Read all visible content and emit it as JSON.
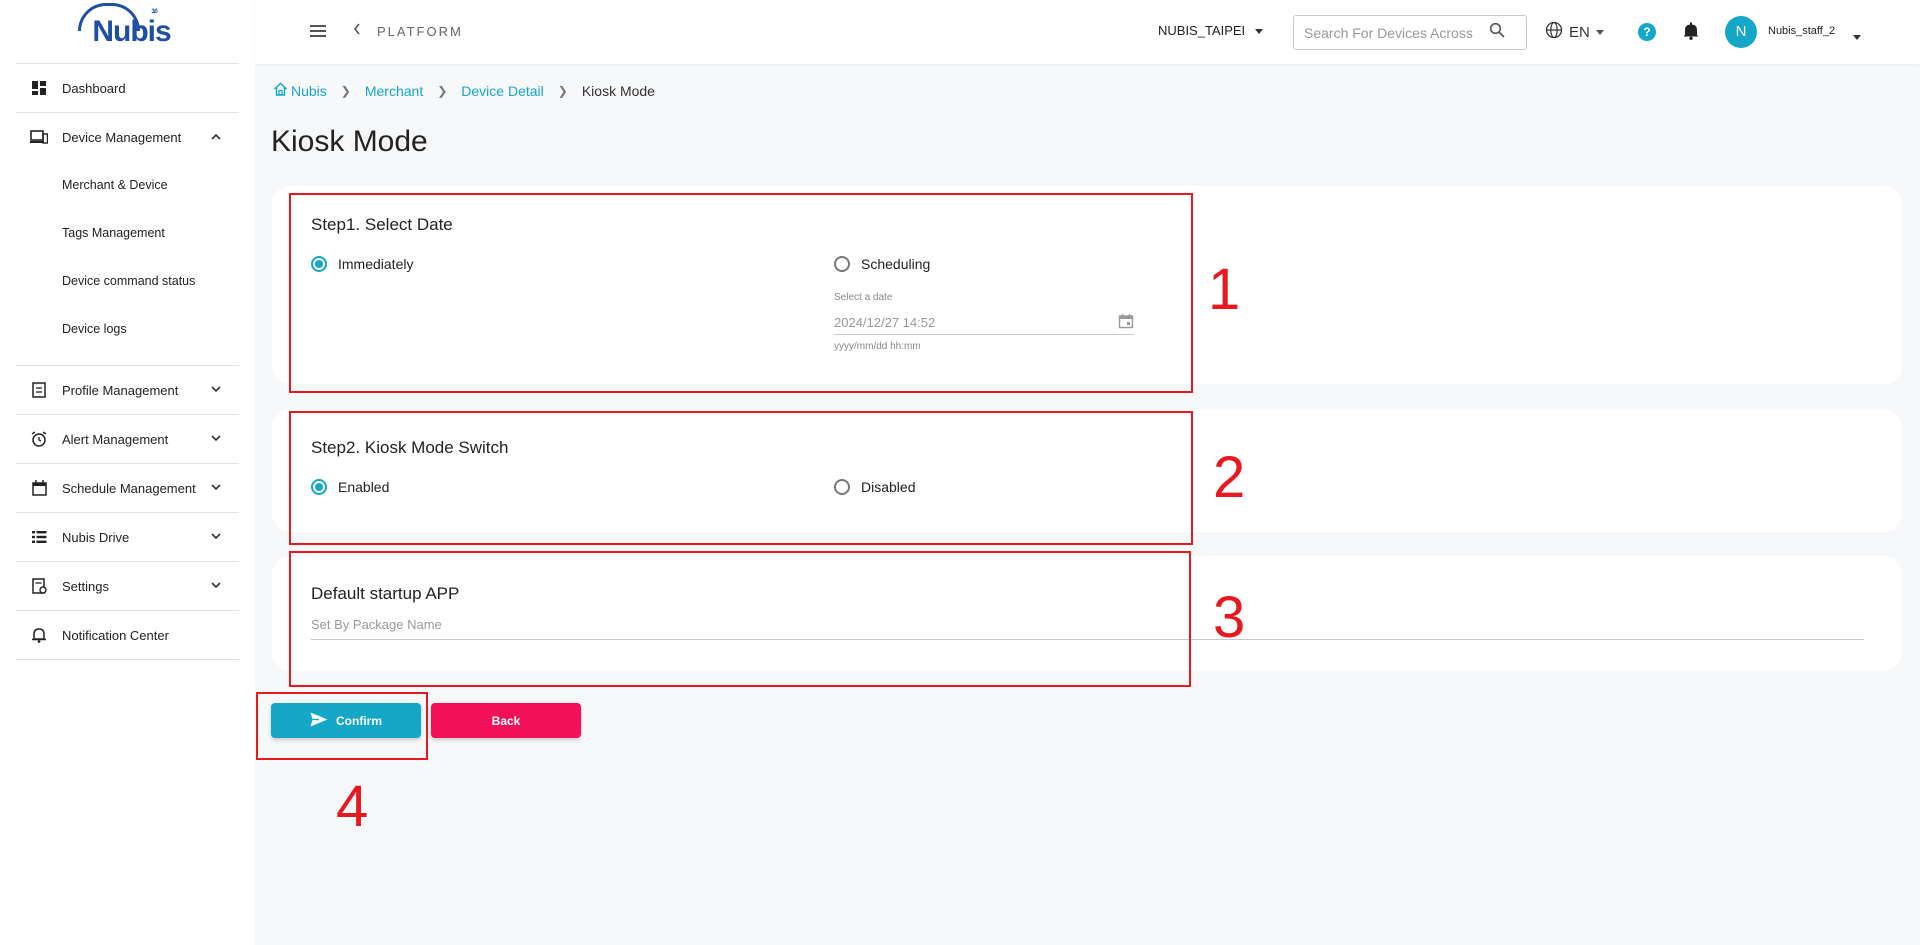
{
  "app": {
    "logo_text": "Nubis",
    "logo_sup": "3.0",
    "platform_label": "PLATFORM"
  },
  "sidebar": {
    "items": [
      {
        "label": "Dashboard",
        "icon": "dashboard-icon"
      },
      {
        "label": "Device Management",
        "icon": "devices-icon",
        "expanded": true,
        "children": [
          "Merchant & Device",
          "Tags Management",
          "Device command status",
          "Device logs"
        ]
      },
      {
        "label": "Profile Management",
        "icon": "profile-icon"
      },
      {
        "label": "Alert Management",
        "icon": "alarm-icon"
      },
      {
        "label": "Schedule Management",
        "icon": "calendar-icon"
      },
      {
        "label": "Nubis Drive",
        "icon": "list-icon"
      },
      {
        "label": "Settings",
        "icon": "settings-icon"
      },
      {
        "label": "Notification Center",
        "icon": "bell-outline-icon"
      }
    ]
  },
  "header": {
    "org": "NUBIS_TAIPEI",
    "search_placeholder": "Search For Devices Across",
    "language": "EN",
    "help": "?",
    "avatar_initial": "N",
    "username": "Nubis_staff_2"
  },
  "breadcrumb": [
    "Nubis",
    "Merchant",
    "Device Detail",
    "Kiosk Mode"
  ],
  "page_title": "Kiosk Mode",
  "step1": {
    "title": "Step1. Select Date",
    "option_immediately": "Immediately",
    "option_scheduling": "Scheduling",
    "selected": "Immediately",
    "date_label": "Select a date",
    "date_value": "2024/12/27 14:52",
    "date_hint": "yyyy/mm/dd hh:mm"
  },
  "step2": {
    "title": "Step2. Kiosk Mode Switch",
    "option_enabled": "Enabled",
    "option_disabled": "Disabled",
    "selected": "Enabled"
  },
  "step3": {
    "title": "Default startup APP",
    "placeholder": "Set By Package Name"
  },
  "buttons": {
    "confirm": "Confirm",
    "back": "Back"
  },
  "annotations": [
    "1",
    "2",
    "3",
    "4"
  ],
  "colors": {
    "accent": "#14a7c7",
    "danger": "#f0115a",
    "annotation": "#e8191e"
  }
}
